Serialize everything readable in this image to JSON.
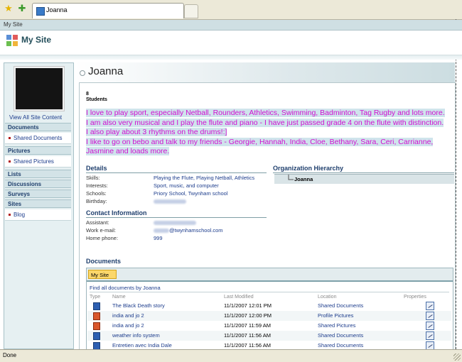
{
  "browser": {
    "tab_title": "Joanna",
    "status": "Done"
  },
  "site": {
    "breadcrumb": "My Site",
    "title": "My Site"
  },
  "leftnav": {
    "view_all": "View All Site Content",
    "sections": [
      {
        "title": "Documents",
        "items": [
          "Shared Documents"
        ]
      },
      {
        "title": "Pictures",
        "items": [
          "Shared Pictures"
        ]
      },
      {
        "title": "Lists",
        "items": []
      },
      {
        "title": "Discussions",
        "items": []
      },
      {
        "title": "Surveys",
        "items": []
      },
      {
        "title": "Sites",
        "items": [
          "Blog"
        ]
      }
    ]
  },
  "profile": {
    "name": "Joanna",
    "stat_number": "8",
    "stat_label": "Students",
    "about_1": "I love to play sport, especially Netball, Rounders, Athletics, Swimming, Badminton, Tag Rugby and lots more. I am also very musical and I play the flute and piano - I have just passed grade 4 on the flute with distinction. I also play about 3 rhythms on the drums!:]",
    "about_2": "I like to go on bebo and talk to my friends - Georgie, Hannah, India, Cloe, Bethany, Sara, Ceri, Carrianne, Jasmine and loads more."
  },
  "details": {
    "title": "Details",
    "skills_label": "Skills:",
    "skills_value": "Playing the Flute, Playing Netball, Athletics",
    "interests_label": "Interests:",
    "interests_value": "Sport, music, and computer",
    "schools_label": "Schools:",
    "schools_value": "Priory School, Twynham school",
    "birthday_label": "Birthday:"
  },
  "contact": {
    "title": "Contact Information",
    "assistant_label": "Assistant:",
    "email_label": "Work e-mail:",
    "email_value": "@twynhamschool.com",
    "phone_label": "Home phone:",
    "phone_value": "999"
  },
  "org": {
    "title": "Organization Hierarchy",
    "current": "Joanna"
  },
  "documents": {
    "title": "Documents",
    "tab": "My Site",
    "find_link": "Find all documents by Joanna",
    "columns": [
      "Type",
      "Name",
      "Last Modified",
      "Location",
      "Properties"
    ],
    "rows": [
      {
        "name": "The Black Death story",
        "modified": "11/1/2007 12:01 PM",
        "location": "Shared Documents"
      },
      {
        "name": "india and jo 2",
        "modified": "11/1/2007 12:00 PM",
        "location": "Profile Pictures"
      },
      {
        "name": "india and jo 2",
        "modified": "11/1/2007 11:59 AM",
        "location": "Shared Pictures"
      },
      {
        "name": "weather info system",
        "modified": "11/1/2007 11:56 AM",
        "location": "Shared Documents"
      },
      {
        "name": "Entretien avec India Dale",
        "modified": "11/1/2007 11:56 AM",
        "location": "Shared Documents"
      }
    ]
  },
  "colors": {
    "about_text": "#d10fd1",
    "link": "#1c3c8c",
    "tab_highlight": "#fbd76b"
  }
}
